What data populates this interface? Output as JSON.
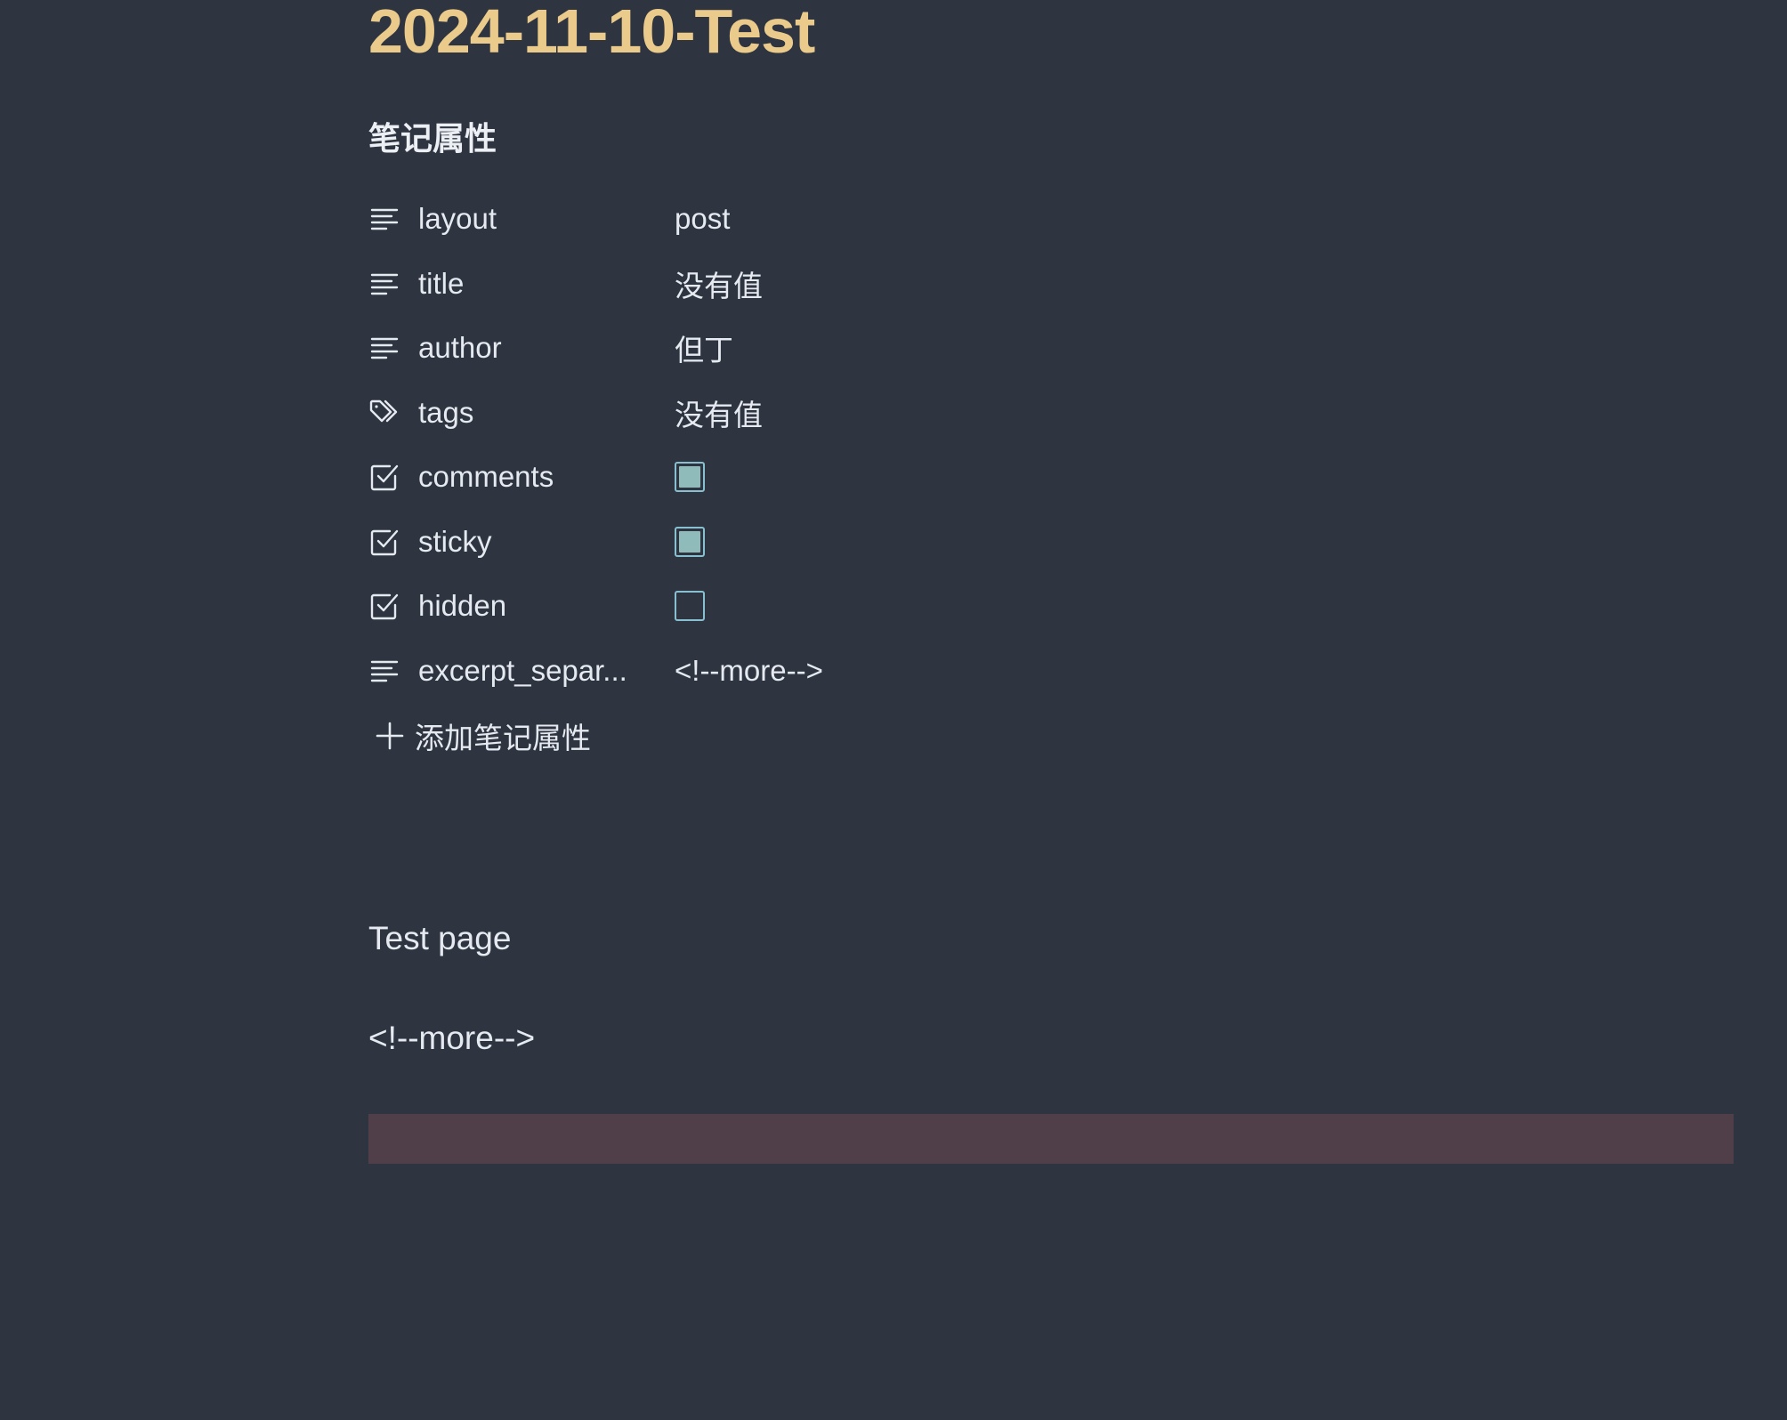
{
  "note": {
    "title": "2024-11-10-Test",
    "properties_heading": "笔记属性",
    "properties": [
      {
        "key": "layout",
        "type": "text",
        "icon": "text-lines-icon",
        "value": "post"
      },
      {
        "key": "title",
        "type": "text",
        "icon": "text-lines-icon",
        "value": "没有值"
      },
      {
        "key": "author",
        "type": "text",
        "icon": "text-lines-icon",
        "value": "但丁"
      },
      {
        "key": "tags",
        "type": "tags",
        "icon": "tags-icon",
        "value": "没有值"
      },
      {
        "key": "comments",
        "type": "checkbox",
        "icon": "checkbox-icon",
        "checked": true
      },
      {
        "key": "sticky",
        "type": "checkbox",
        "icon": "checkbox-icon",
        "checked": true
      },
      {
        "key": "hidden",
        "type": "checkbox",
        "icon": "checkbox-icon",
        "checked": false
      },
      {
        "key": "excerpt_separ...",
        "type": "text",
        "icon": "text-lines-icon",
        "value": "<!--more-->"
      }
    ],
    "add_property_label": "添加笔记属性",
    "body": {
      "paragraph_1": "Test page",
      "paragraph_2": "<!--more-->"
    }
  },
  "colors": {
    "background": "#2e3440",
    "title": "#ebcb8b",
    "text": "#e5e9f0",
    "checkbox_border": "#88c0d0",
    "checkbox_fill": "#8fbcbb",
    "highlight_block": "#503f49"
  }
}
